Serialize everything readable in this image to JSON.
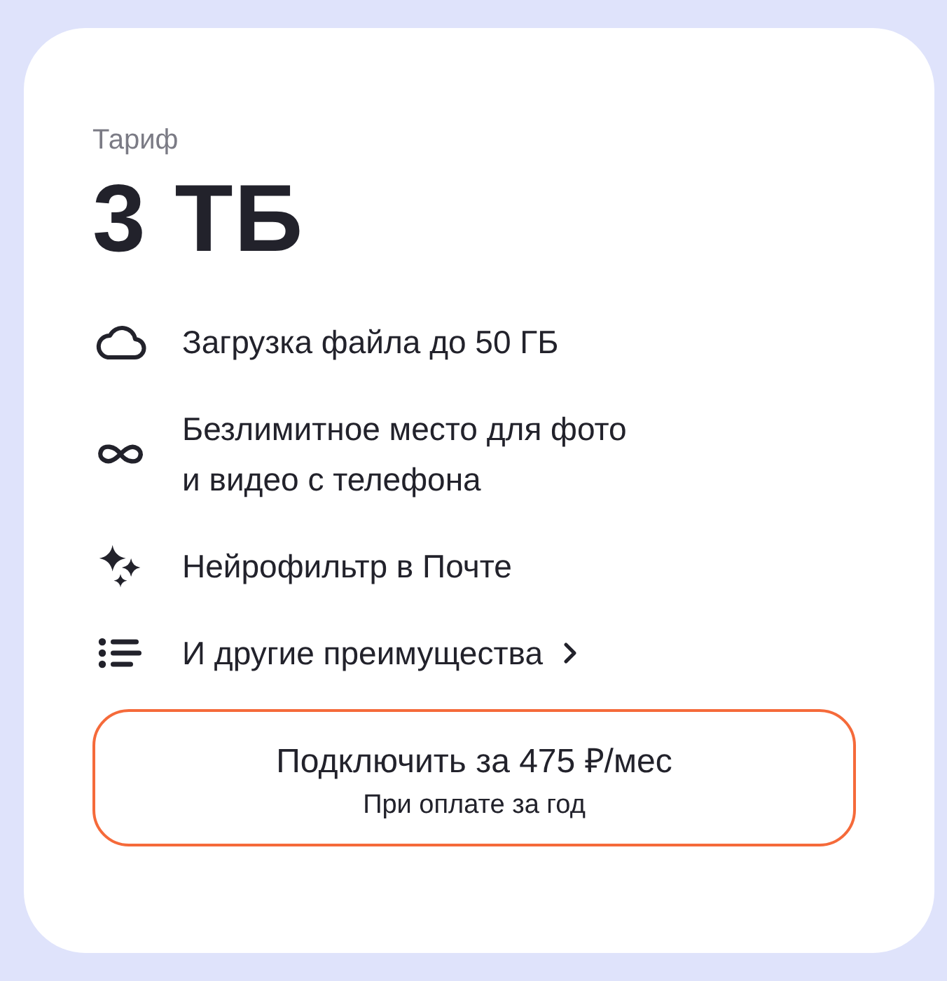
{
  "plan": {
    "label": "Тариф",
    "title": "3 ТБ"
  },
  "features": [
    {
      "kind": "feature",
      "text": "Загрузка файла до 50 ГБ"
    },
    {
      "kind": "feature",
      "text": "Безлимитное место для фото\nи видео с телефона"
    },
    {
      "kind": "feature",
      "text": "Нейрофильтр в Почте"
    },
    {
      "kind": "link",
      "text": "И другие преимущества"
    }
  ],
  "subscribe_button": {
    "title": "Подключить за 475 ₽/мес",
    "subtitle": "При оплате за год"
  }
}
